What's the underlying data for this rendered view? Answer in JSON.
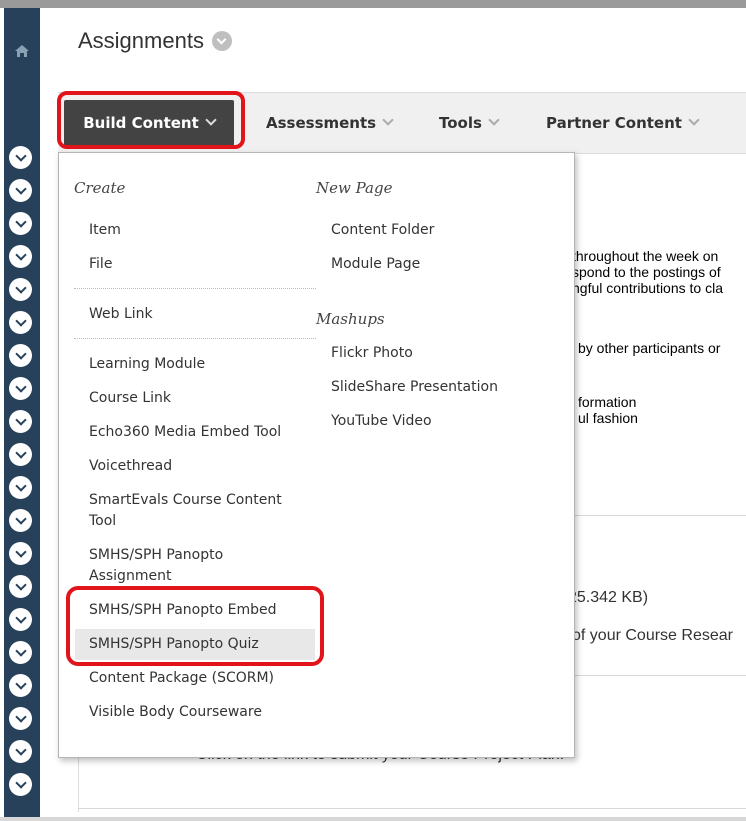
{
  "page": {
    "title": "Assignments"
  },
  "toolbar": {
    "build_content": "Build Content",
    "assessments": "Assessments",
    "tools": "Tools",
    "partner_content": "Partner Content"
  },
  "menu": {
    "create_title": "Create",
    "new_page_title": "New Page",
    "mashups_title": "Mashups",
    "create_items": [
      "Item",
      "File",
      "Web Link",
      "Learning Module",
      "Course Link",
      "Echo360 Media Embed Tool",
      "Voicethread",
      "SmartEvals Course Content Tool",
      "SMHS/SPH Panopto Assignment",
      "SMHS/SPH Panopto Embed",
      "SMHS/SPH Panopto Quiz",
      "Content Package (SCORM)",
      "Visible Body Courseware"
    ],
    "new_page_items": [
      "Content Folder",
      "Module Page"
    ],
    "mashup_items": [
      "Flickr Photo",
      "SlideShare Presentation",
      "YouTube Video"
    ]
  },
  "background": {
    "line1": "throughout the week on",
    "line2": "spond to the postings of",
    "line3": "ngful contributions to cla",
    "line4": "by other participants or",
    "line5": "formation",
    "line6": "ul fashion",
    "line7": "25.342 KB)",
    "line8": "of your Course Resear",
    "line9": "Click on the link to submit your Course Project Plan."
  }
}
